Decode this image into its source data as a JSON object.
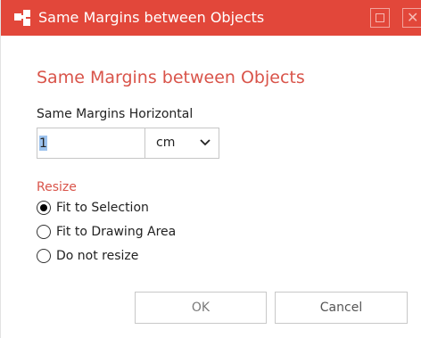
{
  "window": {
    "title": "Same Margins between Objects",
    "accent_color": "#e2473a",
    "icons": {
      "app": "puzzle-icon",
      "maximize": "maximize-icon",
      "close": "close-icon"
    },
    "close_glyph": "✕"
  },
  "dialog": {
    "heading": "Same Margins between Objects",
    "horizontal_label": "Same Margins Horizontal",
    "horizontal_value": "1",
    "unit": "cm",
    "resize_label": "Resize",
    "resize_options": [
      {
        "label": "Fit to Selection",
        "checked": true
      },
      {
        "label": "Fit to Drawing Area",
        "checked": false
      },
      {
        "label": "Do not resize",
        "checked": false
      }
    ]
  },
  "buttons": {
    "ok": "OK",
    "cancel": "Cancel"
  }
}
